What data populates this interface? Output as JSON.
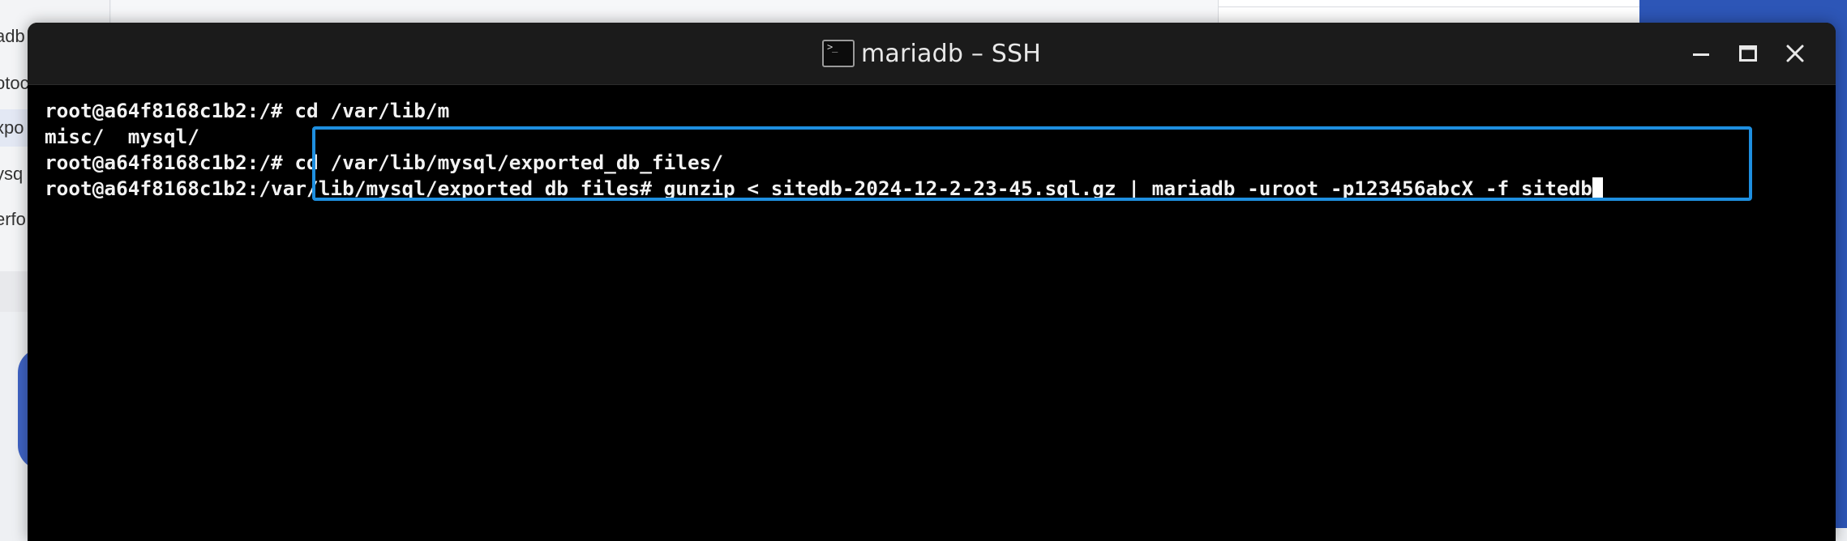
{
  "background": {
    "sidebar_fragments": [
      "adb",
      "otoc",
      "xpo",
      "ysq",
      "erfo"
    ]
  },
  "window": {
    "title": "mariadb – SSH",
    "controls": {
      "minimize": "minimize-icon",
      "maximize": "maximize-icon",
      "close": "close-icon"
    }
  },
  "terminal": {
    "lines": [
      "root@a64f8168c1b2:/# cd /var/lib/m",
      "misc/  mysql/",
      "root@a64f8168c1b2:/# cd /var/lib/mysql/exported_db_files/",
      "root@a64f8168c1b2:/var/lib/mysql/exported_db_files# gunzip < sitedb-2024-12-2-23-45.sql.gz | mariadb -uroot -p123456abcX -f sitedb"
    ]
  },
  "colors": {
    "highlight": "#1e8fe0",
    "terminal_bg": "#000000",
    "terminal_fg": "#f2f2f2",
    "background_accent": "#2d56b7"
  }
}
